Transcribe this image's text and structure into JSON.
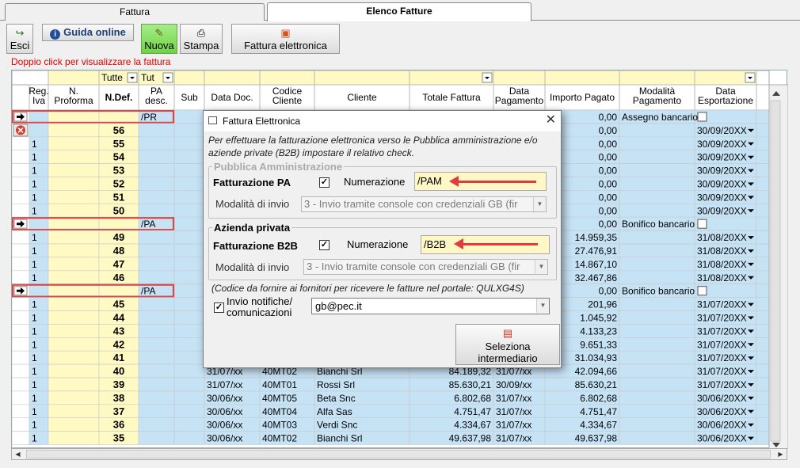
{
  "tabs": [
    "Fattura",
    "Elenco Fatture"
  ],
  "toolbar": {
    "esci": "Esci",
    "guida": "Guida online",
    "nuova": "Nuova",
    "stampa": "Stampa",
    "fattura_el": "Fattura elettronica"
  },
  "hint": "Doppio click per visualizzare la fattura",
  "filters": {
    "ndef": "Tutte",
    "pa": "Tut"
  },
  "columns": [
    "Reg. Iva",
    "N. Proforma",
    "N.Def.",
    "PA desc.",
    "Sub",
    "Data Doc.",
    "Codice Cliente",
    "Cliente",
    "Totale Fattura",
    "Data Pagamento",
    "Importo Pagato",
    "Modalità Pagamento",
    "Data Esportazione"
  ],
  "rows": [
    {
      "t": "proforma",
      "pa": "/PR",
      "imp": "0,00",
      "mod": "Assegno bancario"
    },
    {
      "t": "del",
      "ndef": "56",
      "imp": "0,00",
      "esp": "30/09/20XX"
    },
    {
      "reg": "1",
      "ndef": "55",
      "imp": "0,00",
      "esp": "30/09/20XX"
    },
    {
      "reg": "1",
      "ndef": "54",
      "imp": "0,00",
      "esp": "30/09/20XX"
    },
    {
      "reg": "1",
      "ndef": "53",
      "imp": "0,00",
      "esp": "30/09/20XX"
    },
    {
      "reg": "1",
      "ndef": "52",
      "imp": "0,00",
      "esp": "30/09/20XX"
    },
    {
      "reg": "1",
      "ndef": "51",
      "imp": "0,00",
      "esp": "30/09/20XX"
    },
    {
      "reg": "1",
      "ndef": "50",
      "imp": "0,00",
      "esp": "30/09/20XX"
    },
    {
      "t": "proforma",
      "pa": "/PA",
      "imp": "0,00",
      "mod": "Bonifico bancario"
    },
    {
      "reg": "1",
      "ndef": "49",
      "imp": "14.959,35",
      "esp": "31/08/20XX"
    },
    {
      "reg": "1",
      "ndef": "48",
      "imp": "27.476,91",
      "esp": "31/08/20XX"
    },
    {
      "reg": "1",
      "ndef": "47",
      "imp": "14.867,10",
      "esp": "31/08/20XX"
    },
    {
      "reg": "1",
      "ndef": "46",
      "imp": "32.467,86",
      "esp": "31/08/20XX"
    },
    {
      "t": "proforma",
      "pa": "/PA",
      "imp": "0,00",
      "mod": "Bonifico bancario"
    },
    {
      "reg": "1",
      "ndef": "45",
      "imp": "201,96",
      "esp": "31/07/20XX"
    },
    {
      "reg": "1",
      "ndef": "44",
      "imp": "1.045,92",
      "esp": "31/07/20XX"
    },
    {
      "reg": "1",
      "ndef": "43",
      "imp": "4.133,23",
      "esp": "31/07/20XX"
    },
    {
      "reg": "1",
      "ndef": "42",
      "imp": "9.651,33",
      "esp": "31/07/20XX"
    },
    {
      "reg": "1",
      "ndef": "41",
      "imp": "31.034,93",
      "esp": "31/07/20XX"
    },
    {
      "reg": "1",
      "ndef": "40",
      "doc": "31/07/xx",
      "cod": "40MT02",
      "cli": "Bianchi Srl",
      "tot": "84.189,32",
      "pag": "31/07/xx",
      "imp": "42.094,66",
      "esp": "31/07/20XX"
    },
    {
      "reg": "1",
      "ndef": "39",
      "doc": "31/07/xx",
      "cod": "40MT01",
      "cli": "Rossi Srl",
      "tot": "85.630,21",
      "pag": "30/09/xx",
      "imp": "85.630,21",
      "esp": "31/07/20XX"
    },
    {
      "reg": "1",
      "ndef": "38",
      "doc": "30/06/xx",
      "cod": "40MT05",
      "cli": "Beta Snc",
      "tot": "6.802,68",
      "pag": "31/07/xx",
      "imp": "6.802,68",
      "esp": "30/06/20XX"
    },
    {
      "reg": "1",
      "ndef": "37",
      "doc": "30/06/xx",
      "cod": "40MT04",
      "cli": "Alfa Sas",
      "tot": "4.751,47",
      "pag": "31/07/xx",
      "imp": "4.751,47",
      "esp": "30/06/20XX"
    },
    {
      "reg": "1",
      "ndef": "36",
      "doc": "30/06/xx",
      "cod": "40MT03",
      "cli": "Verdi Snc",
      "tot": "4.334,67",
      "pag": "31/07/xx",
      "imp": "4.334,67",
      "esp": "30/06/20XX"
    },
    {
      "reg": "1",
      "ndef": "35",
      "doc": "30/06/xx",
      "cod": "40MT02",
      "cli": "Bianchi Srl",
      "tot": "49.637,98",
      "pag": "31/07/xx",
      "imp": "49.637,98",
      "esp": "30/06/20XX"
    }
  ],
  "dialog": {
    "title": "Fattura Elettronica",
    "intro": "Per effettuare la fatturazione elettronica verso le Pubblica amministrazione e/o aziende private (B2B) impostare il relativo check.",
    "pa_group": "Pubblica Amministrazione",
    "pa_label": "Fatturazione PA",
    "num_label": "Numerazione",
    "pa_num": "/PAM",
    "mod_label": "Modalità di invio",
    "mod_value": "3 - Invio tramite console con credenziali GB (fir",
    "b2b_group": "Azienda privata",
    "b2b_label": "Fatturazione B2B",
    "b2b_num": "/B2B",
    "code_note": "(Codice da fornire ai fornitori per ricevere le fatture nel portale: QULXG4S)",
    "notif_label": "Invio notifiche/ comunicazioni",
    "email": "gb@pec.it",
    "intermediario": "Seleziona intermediario"
  },
  "colors": {
    "yellow": "#fff9c4",
    "blue": "#c6e2f5",
    "highlight": "#d94848",
    "arrow": "#e23b3b"
  }
}
